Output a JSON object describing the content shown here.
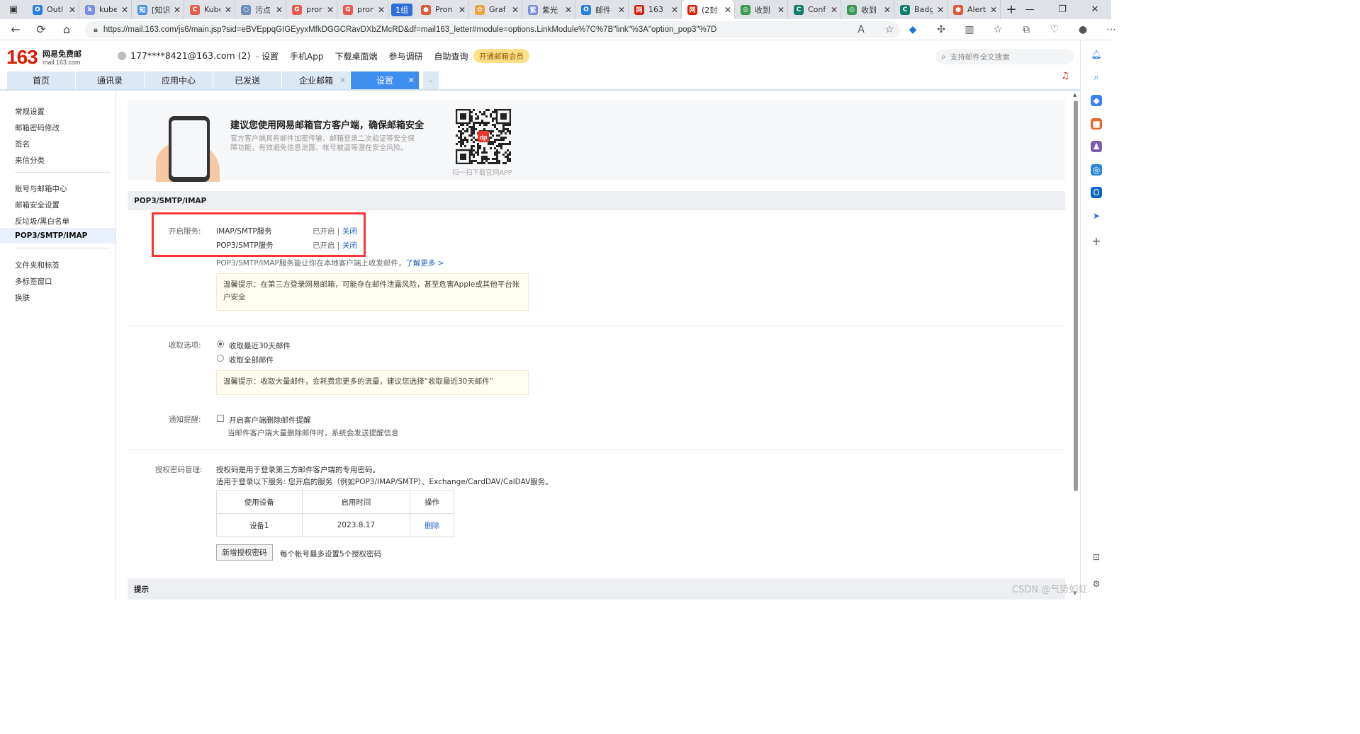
{
  "browser": {
    "tabs": [
      {
        "title": "Outl",
        "color": "#2a7de1",
        "glyph": "O"
      },
      {
        "title": "kube",
        "color": "#7b8cde",
        "glyph": "k"
      },
      {
        "title": "[知识",
        "color": "#4a90e2",
        "glyph": "知"
      },
      {
        "title": "Kube",
        "color": "#e0604a",
        "glyph": "C"
      },
      {
        "title": "污点",
        "color": "#6c8ebf",
        "glyph": "○"
      },
      {
        "title": "pron",
        "color": "#e35b4e",
        "glyph": "G"
      },
      {
        "title": "pron",
        "color": "#e35b4e",
        "glyph": "G"
      },
      {
        "title": "Pron",
        "color": "#e0583c",
        "glyph": "●"
      },
      {
        "title": "Graf",
        "color": "#f0a23a",
        "glyph": "✿"
      },
      {
        "title": "紫光",
        "color": "#7b8cde",
        "glyph": "紫"
      },
      {
        "title": "邮件",
        "color": "#2a7de1",
        "glyph": "O"
      },
      {
        "title": "163",
        "color": "#d81e06",
        "glyph": "网"
      },
      {
        "title": "(2封",
        "color": "#d81e06",
        "glyph": "网"
      },
      {
        "title": "收到",
        "color": "#3a9a52",
        "glyph": "◎"
      },
      {
        "title": "Conf",
        "color": "#127d6a",
        "glyph": "C"
      },
      {
        "title": "收到",
        "color": "#3a9a52",
        "glyph": "◎"
      },
      {
        "title": "Badg",
        "color": "#127d6a",
        "glyph": "C"
      },
      {
        "title": "Alert",
        "color": "#e0583c",
        "glyph": "●"
      }
    ],
    "group_label": "1组",
    "url": "https://mail.163.com/js6/main.jsp?sid=eBVEppqGIGEyyxMfkDGGCRavDXbZMcRD&df=mail163_letter#module=options.LinkModule%7C%7B\"link\"%3A\"option_pop3\"%7D"
  },
  "mail": {
    "logo_number": "163",
    "logo_text": "网易免费邮",
    "logo_sub": "mail.163.com",
    "account": "177****8421@163.com (2)",
    "topnav": [
      "设置",
      "手机App",
      "下载桌面端",
      "参与调研",
      "自助查询"
    ],
    "vip_label": "开通邮箱会员",
    "search_placeholder": "支持邮件全文搜索",
    "module_tabs": [
      {
        "label": "首页",
        "width": 96
      },
      {
        "label": "通讯录",
        "width": 96
      },
      {
        "label": "应用中心",
        "width": 96
      },
      {
        "label": "已发送",
        "width": 96
      },
      {
        "label": "企业邮箱",
        "width": 96
      },
      {
        "label": "设置",
        "width": 96
      }
    ]
  },
  "leftnav": {
    "group1": [
      "常规设置",
      "邮箱密码修改",
      "签名",
      "来信分类"
    ],
    "group2": [
      "账号与邮箱中心",
      "邮箱安全设置",
      "反垃圾/黑白名单",
      "POP3/SMTP/IMAP"
    ],
    "group3": [
      "文件夹和标签",
      "多标签窗口",
      "换肤"
    ]
  },
  "banner": {
    "title": "建议您使用网易邮箱官方客户端，确保邮箱安全",
    "desc": "官方客户端具有邮件加密传输、邮箱登录二次验证等安全保障功能，有效避免信息泄露、帐号被盗等潜在安全风险。",
    "qr_caption": "扫一扫下载官网APP",
    "qr_badge": "dp"
  },
  "pop3": {
    "section_title": "POP3/SMTP/IMAP",
    "enable_label": "开启服务:",
    "services": [
      {
        "name": "IMAP/SMTP服务",
        "status": "已开启",
        "sep": " | ",
        "action": "关闭"
      },
      {
        "name": "POP3/SMTP服务",
        "status": "已开启",
        "sep": " | ",
        "action": "关闭"
      }
    ],
    "desc": "POP3/SMTP/IMAP服务能让你在本地客户端上收发邮件，",
    "learn_more": "了解更多 >",
    "tip1": "温馨提示：在第三方登录网易邮箱，可能存在邮件泄露风险，甚至危害Apple或其他平台账户安全",
    "receive_label": "收取选项:",
    "receive_options": [
      "收取最近30天邮件",
      "收取全部邮件"
    ],
    "tip2": "温馨提示：收取大量邮件，会耗费您更多的流量，建议您选择“收取最近30天邮件”",
    "notify_label": "通知提醒:",
    "notify_option": "开启客户端删除邮件提醒",
    "notify_desc": "当邮件客户端大量删除邮件时，系统会发送提醒信息",
    "auth_label": "授权密码管理:",
    "auth_desc1": "授权码是用于登录第三方邮件客户端的专用密码。",
    "auth_desc2": "适用于登录以下服务: 您开启的服务（例如POP3/IMAP/SMTP）、Exchange/CardDAV/CalDAV服务。",
    "table_headers": [
      "使用设备",
      "启用时间",
      "操作"
    ],
    "table_rows": [
      {
        "device": "设备1",
        "time": "2023.8.17",
        "action": "删除"
      }
    ],
    "new_button": "新增授权密码",
    "limit_note": "每个帐号最多设置5个授权密码",
    "hint_title": "提示"
  },
  "watermark": "CSDN @气势如虹"
}
